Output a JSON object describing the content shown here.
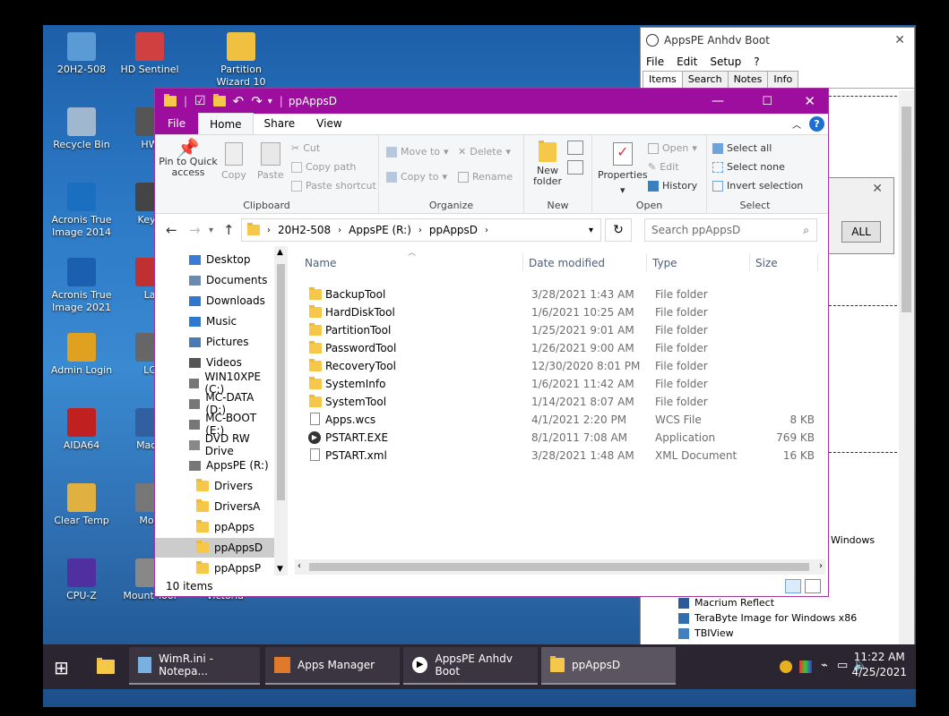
{
  "desktop": {
    "icons": [
      {
        "label": "20H2-508",
        "color": "#5b9bd5"
      },
      {
        "label": "HD Sentinel",
        "color": "#d04040"
      },
      {
        "label": "Partition Wizard 10",
        "color": "#f0c040"
      },
      {
        "label": "Recycle Bin",
        "color": "#9fb8d0"
      },
      {
        "label": "HW",
        "color": "#555555"
      },
      {
        "label": "Acronis True Image 2014",
        "color": "#1a6fc0"
      },
      {
        "label": "Keyb",
        "color": "#444444"
      },
      {
        "label": "Acronis True Image 2021",
        "color": "#1a5fb0"
      },
      {
        "label": "La",
        "color": "#c03030"
      },
      {
        "label": "Admin Login",
        "color": "#e0a020"
      },
      {
        "label": "LC",
        "color": "#666666"
      },
      {
        "label": "AIDA64",
        "color": "#c02020"
      },
      {
        "label": "Macri",
        "color": "#3060a0"
      },
      {
        "label": "Clear Temp",
        "color": "#e0b040"
      },
      {
        "label": "Mou",
        "color": "#777777"
      },
      {
        "label": "CPU-Z",
        "color": "#5030a0"
      },
      {
        "label": "Mount Tool",
        "color": "#888888"
      },
      {
        "label": "Victoria",
        "color": "#999999"
      }
    ]
  },
  "apps_window": {
    "title": "AppsPE Anhdv Boot",
    "menu": [
      "File",
      "Edit",
      "Setup",
      "?"
    ],
    "tabs": [
      "Items",
      "Search",
      "Notes",
      "Info"
    ],
    "list": [
      "Windows",
      "Macrium Reflect",
      "TeraByte Image for Windows x86",
      "TBIView"
    ],
    "dialog_btn": "ALL"
  },
  "explorer": {
    "title": "ppAppsD",
    "tabs": {
      "file": "File",
      "home": "Home",
      "share": "Share",
      "view": "View"
    },
    "ribbon": {
      "pin": "Pin to Quick access",
      "copy": "Copy",
      "paste": "Paste",
      "cut": "Cut",
      "copy_path": "Copy path",
      "paste_shortcut": "Paste shortcut",
      "clipboard": "Clipboard",
      "move_to": "Move to",
      "copy_to": "Copy to",
      "delete": "Delete",
      "rename": "Rename",
      "organize": "Organize",
      "new_folder": "New folder",
      "new": "New",
      "properties": "Properties",
      "open_btn": "Open",
      "edit": "Edit",
      "history": "History",
      "open_group": "Open",
      "select_all": "Select all",
      "select_none": "Select none",
      "invert": "Invert selection",
      "select": "Select"
    },
    "address": [
      "20H2-508",
      "AppsPE (R:)",
      "ppAppsD"
    ],
    "search_placeholder": "Search ppAppsD",
    "nav": [
      "Desktop",
      "Documents",
      "Downloads",
      "Music",
      "Pictures",
      "Videos",
      "WIN10XPE (C:)",
      "MC-DATA (D:)",
      "MC-BOOT (E:)",
      "DVD RW Drive",
      "AppsPE (R:)",
      "Drivers",
      "DriversA",
      "ppApps",
      "ppAppsD",
      "ppAppsP"
    ],
    "columns": {
      "name": "Name",
      "date": "Date modified",
      "type": "Type",
      "size": "Size"
    },
    "files": [
      {
        "name": "BackupTool",
        "date": "3/28/2021 1:43 AM",
        "type": "File folder",
        "size": ""
      },
      {
        "name": "HardDiskTool",
        "date": "1/6/2021 10:25 AM",
        "type": "File folder",
        "size": ""
      },
      {
        "name": "PartitionTool",
        "date": "1/25/2021 9:01 AM",
        "type": "File folder",
        "size": ""
      },
      {
        "name": "PasswordTool",
        "date": "1/26/2021 9:00 AM",
        "type": "File folder",
        "size": ""
      },
      {
        "name": "RecoveryTool",
        "date": "12/30/2020 8:01 PM",
        "type": "File folder",
        "size": ""
      },
      {
        "name": "SystemInfo",
        "date": "1/6/2021 11:42 AM",
        "type": "File folder",
        "size": ""
      },
      {
        "name": "SystemTool",
        "date": "1/14/2021 8:07 AM",
        "type": "File folder",
        "size": ""
      },
      {
        "name": "Apps.wcs",
        "date": "4/1/2021 2:20 PM",
        "type": "WCS File",
        "size": "8 KB"
      },
      {
        "name": "PSTART.EXE",
        "date": "8/1/2011 7:08 AM",
        "type": "Application",
        "size": "769 KB"
      },
      {
        "name": "PSTART.xml",
        "date": "3/28/2021 1:48 AM",
        "type": "XML Document",
        "size": "16 KB"
      }
    ],
    "status": "10 items"
  },
  "taskbar": {
    "items": [
      "WimR.ini - Notepa...",
      "Apps Manager",
      "AppsPE Anhdv Boot",
      "ppAppsD"
    ],
    "time": "11:22 AM",
    "date": "4/25/2021"
  },
  "colors": {
    "accent": "#9e0e9e",
    "taskbar": "#2a2530"
  }
}
